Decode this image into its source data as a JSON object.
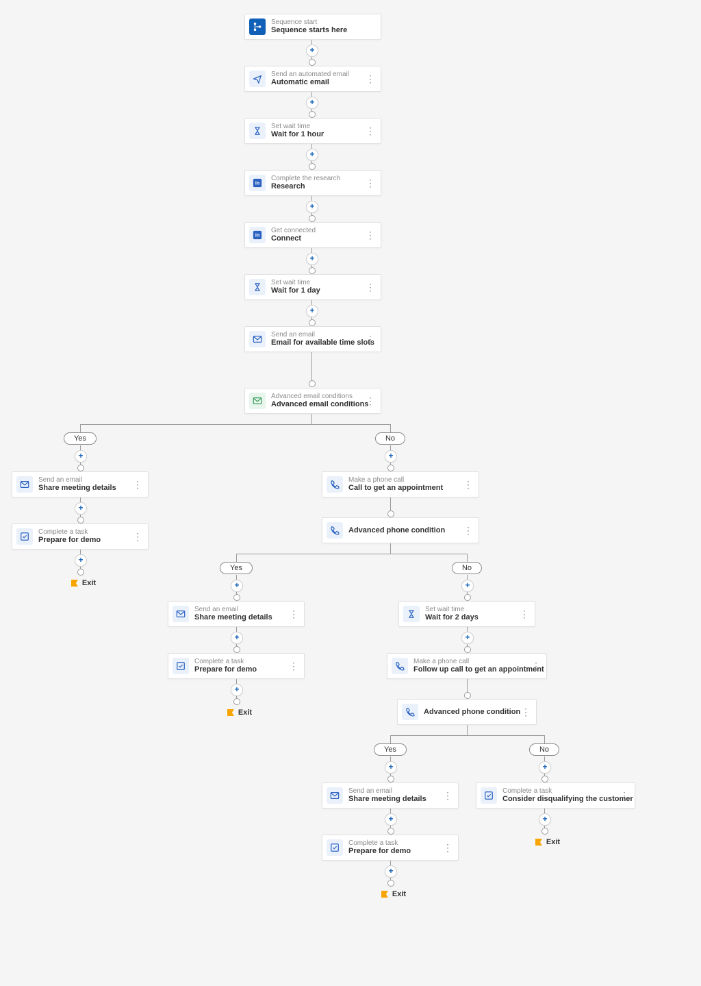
{
  "labels": {
    "yes": "Yes",
    "no": "No",
    "exit": "Exit",
    "more": "⋮"
  },
  "nodes": {
    "start": {
      "sub": "Sequence start",
      "title": "Sequence starts here"
    },
    "email1": {
      "sub": "Send an automated email",
      "title": "Automatic email"
    },
    "wait1h": {
      "sub": "Set wait time",
      "title": "Wait for 1 hour"
    },
    "research": {
      "sub": "Complete the research",
      "title": "Research"
    },
    "connect": {
      "sub": "Get connected",
      "title": "Connect"
    },
    "wait1d": {
      "sub": "Set wait time",
      "title": "Wait for 1 day"
    },
    "email2": {
      "sub": "Send an email",
      "title": "Email for available time slots"
    },
    "advEmail": {
      "sub": "Advanced email conditions",
      "title": "Advanced email conditions"
    },
    "shareA": {
      "sub": "Send an email",
      "title": "Share meeting details"
    },
    "prepA": {
      "sub": "Complete a task",
      "title": "Prepare for demo"
    },
    "call1": {
      "sub": "Make a phone call",
      "title": "Call to get an appointment"
    },
    "advPhone1": {
      "title": "Advanced phone condition"
    },
    "shareB": {
      "sub": "Send an email",
      "title": "Share meeting details"
    },
    "prepB": {
      "sub": "Complete a task",
      "title": "Prepare for demo"
    },
    "wait2d": {
      "sub": "Set wait time",
      "title": "Wait for 2 days"
    },
    "call2": {
      "sub": "Make a phone call",
      "title": "Follow up call to get an appointment"
    },
    "advPhone2": {
      "title": "Advanced phone condition"
    },
    "shareC": {
      "sub": "Send an email",
      "title": "Share meeting details"
    },
    "prepC": {
      "sub": "Complete a task",
      "title": "Prepare for demo"
    },
    "disq": {
      "sub": "Complete a task",
      "title": "Consider disqualifying the customer"
    }
  }
}
